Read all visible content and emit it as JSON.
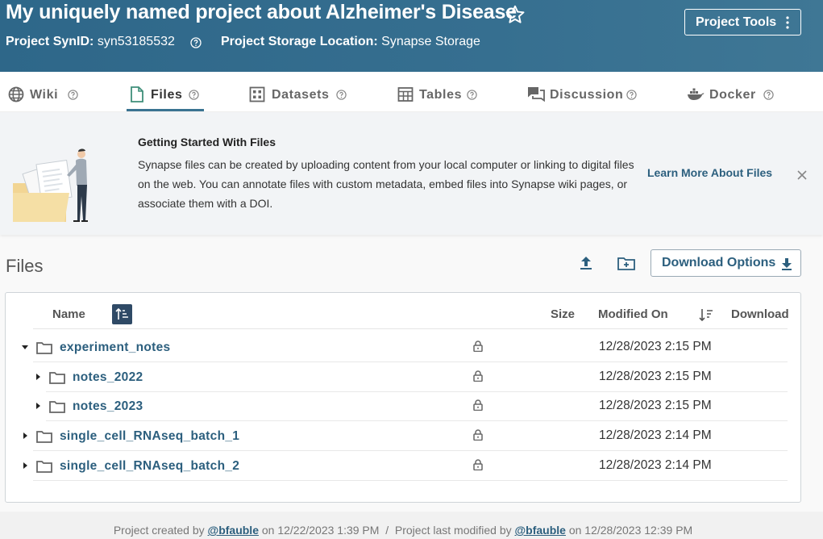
{
  "header": {
    "title": "My uniquely named project about Alzheimer's Disease",
    "synid_label": "Project SynID:",
    "synid_value": "syn53185532",
    "storage_label": "Project Storage Location:",
    "storage_value": "Synapse Storage",
    "tools_label": "Project Tools"
  },
  "tabs": [
    {
      "label": "Wiki",
      "icon": "globe-icon"
    },
    {
      "label": "Files",
      "icon": "file-icon",
      "active": true
    },
    {
      "label": "Datasets",
      "icon": "dataset-icon"
    },
    {
      "label": "Tables",
      "icon": "table-icon"
    },
    {
      "label": "Discussion",
      "icon": "discussion-icon"
    },
    {
      "label": "Docker",
      "icon": "docker-icon"
    }
  ],
  "banner": {
    "title": "Getting Started With Files",
    "body": "Synapse files can be created by uploading content from your local computer or linking to digital files on the web. You can annotate files with custom metadata, embed files into Synapse wiki pages, or associate them with a DOI.",
    "learn_more": "Learn More About Files"
  },
  "files": {
    "section_title": "Files",
    "download_options": "Download Options",
    "columns": {
      "name": "Name",
      "size": "Size",
      "modified": "Modified On",
      "download": "Download"
    },
    "rows": [
      {
        "name": "experiment_notes",
        "modified": "12/28/2023 2:15 PM",
        "expanded": true,
        "level": 0
      },
      {
        "name": "notes_2022",
        "modified": "12/28/2023 2:15 PM",
        "expanded": false,
        "level": 1
      },
      {
        "name": "notes_2023",
        "modified": "12/28/2023 2:15 PM",
        "expanded": false,
        "level": 1
      },
      {
        "name": "single_cell_RNAseq_batch_1",
        "modified": "12/28/2023 2:14 PM",
        "expanded": false,
        "level": 0
      },
      {
        "name": "single_cell_RNAseq_batch_2",
        "modified": "12/28/2023 2:14 PM",
        "expanded": false,
        "level": 0
      }
    ]
  },
  "footer": {
    "created_prefix": "Project created by",
    "created_user": "@bfauble",
    "created_on": "on 12/22/2023 1:39 PM",
    "separator": "/",
    "modified_prefix": "Project last modified by",
    "modified_user": "@bfauble",
    "modified_on": "on 12/28/2023 12:39 PM"
  },
  "colors": {
    "header": "#2f6a8b",
    "link": "#2c5f7e",
    "sort_button": "#2f4a66"
  }
}
